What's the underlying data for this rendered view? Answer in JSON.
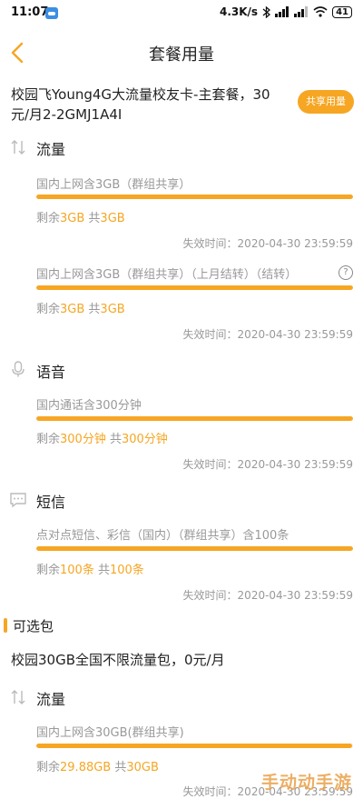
{
  "status_bar": {
    "time": "11:07",
    "speed": "4.3K/s",
    "battery": "41"
  },
  "nav": {
    "title": "套餐用量"
  },
  "plan": {
    "name": "校园飞Young4G大流量校友卡-主套餐，30元/月2-2GMJ1A4I",
    "share_label": "共享用量"
  },
  "colors": {
    "accent": "#f6a623",
    "text_muted": "#999999"
  },
  "sections": [
    {
      "title": "流量",
      "icon": "data-arrows-icon",
      "items": [
        {
          "label": "国内上网含3GB（群组共享）",
          "remain_prefix": "剩余",
          "remain_value": "3GB",
          "total_prefix": " 共",
          "total_value": "3GB",
          "fill": 1.0,
          "expire": "失效时间：2020-04-30 23:59:59"
        },
        {
          "label": "国内上网含3GB（群组共享）（上月结转）（结转）",
          "remain_prefix": "剩余",
          "remain_value": "3GB",
          "total_prefix": " 共",
          "total_value": "3GB",
          "fill": 1.0,
          "expire": "失效时间：2020-04-30 23:59:59",
          "help": "?"
        }
      ]
    },
    {
      "title": "语音",
      "icon": "microphone-icon",
      "items": [
        {
          "label": "国内通话含300分钟",
          "remain_prefix": "剩余",
          "remain_value": "300分钟",
          "total_prefix": " 共",
          "total_value": "300分钟",
          "fill": 1.0,
          "expire": "失效时间：2020-04-30 23:59:59"
        }
      ]
    },
    {
      "title": "短信",
      "icon": "message-icon",
      "items": [
        {
          "label": "点对点短信、彩信（国内）（群组共享）含100条",
          "remain_prefix": "剩余",
          "remain_value": "100条",
          "total_prefix": " 共",
          "total_value": "100条",
          "fill": 1.0,
          "expire": "失效时间：2020-04-30 23:59:59"
        }
      ]
    }
  ],
  "optional": {
    "title": "可选包",
    "package": "校园30GB全国不限流量包，0元/月",
    "section": {
      "title": "流量",
      "icon": "data-arrows-icon",
      "item": {
        "label": "国内上网含30GB(群组共享)",
        "remain_prefix": "剩余",
        "remain_value": "29.88GB",
        "total_prefix": " 共",
        "total_value": "30GB",
        "fill": 0.996,
        "expire": "失效时间：2020-04-30 23:59:59"
      }
    }
  },
  "watermark": "手动动手游"
}
